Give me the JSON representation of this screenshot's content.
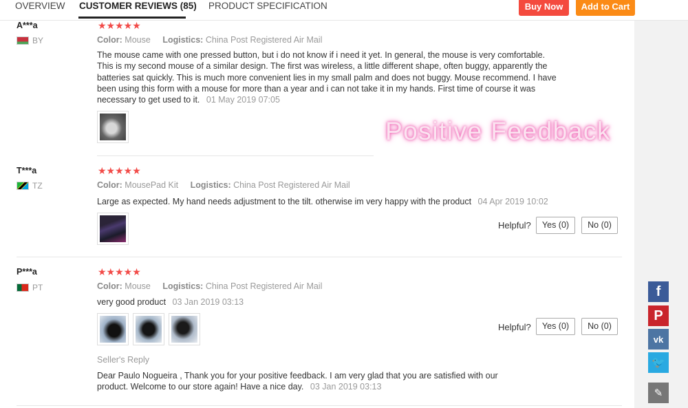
{
  "header": {
    "tabs": [
      {
        "label": "OVERVIEW"
      },
      {
        "label": "CUSTOMER REVIEWS (85)"
      },
      {
        "label": "PRODUCT SPECIFICATION"
      }
    ],
    "buy_now": "Buy Now",
    "add_to_cart": "Add to Cart"
  },
  "watermark": "Positive Feedback",
  "labels": {
    "color": "Color:",
    "logistics": "Logistics:",
    "helpful": "Helpful?",
    "seller_reply": "Seller's Reply"
  },
  "reviews": [
    {
      "user": "A***a",
      "country": "BY",
      "stars": "★★★★★",
      "color": "Mouse",
      "logistics": "China Post Registered Air Mail",
      "text": "The mouse came with one pressed button, but i do not know if i need it yet. In general, the mouse is very comfortable. This is my second mouse of a similar design. The first was wireless, a little different shape, often buggy, apparently the batteries sat quickly. This is much more convenient lies in my small palm and does not buggy. Mouse recommend. I have been using this form with a mouse for more than a year and i can not take it in my hands. First time of course it was necessary to get used to it.",
      "date": "01 May 2019 07:05"
    },
    {
      "user": "T***a",
      "country": "TZ",
      "stars": "★★★★★",
      "color": "MousePad Kit",
      "logistics": "China Post Registered Air Mail",
      "text": "Large as expected. My hand needs adjustment to the tilt. otherwise im very happy with the product",
      "date": "04 Apr 2019 10:02",
      "yes": "Yes (0)",
      "no": "No (0)"
    },
    {
      "user": "P***a",
      "country": "PT",
      "stars": "★★★★★",
      "color": "Mouse",
      "logistics": "China Post Registered Air Mail",
      "text": "very good product",
      "date": "03 Jan 2019 03:13",
      "yes": "Yes (0)",
      "no": "No (0)",
      "reply_text": "Dear Paulo Nogueira , Thank you for your positive feedback. I am very glad that you are satisfied with our product. Welcome to our store again! Have a nice day.",
      "reply_date": "03 Jan 2019 03:13"
    }
  ],
  "social": {
    "facebook": "f",
    "pinterest": "P",
    "vk": "vk",
    "twitter": "🐦",
    "edit": "✎"
  }
}
